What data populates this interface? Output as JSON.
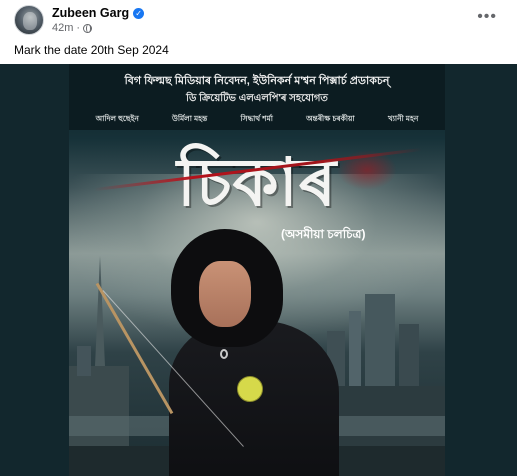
{
  "post": {
    "author": "Zubeen Garg",
    "verified_glyph": "✓",
    "time": "42m",
    "separator": "·",
    "privacy_icon": "globe-icon",
    "more_glyph": "•••",
    "caption": "Mark the date 20th Sep 2024"
  },
  "poster": {
    "production_line1": "বিগ ফিল্মছ মিডিয়াৰ নিবেদন, ইউনিকৰ্ন ম'শ্বন পিক্সাৰ্চ প্ৰডাকচন্‌",
    "production_line2": "ডি ক্ৰিয়েটিভ এলএলপি'ৰ সহযোগত",
    "cast": [
      "আদিল হুছেইন",
      "উৰ্মিলা মহন্ত",
      "সিদ্ধাৰ্থ শৰ্মা",
      "অন্তৰীক্ষ চৰকীয়া",
      "খ্যানী মহন"
    ],
    "title": "চিকাৰ",
    "subtitle": "(অসমীয়া চলচিত্ৰ)"
  },
  "colors": {
    "accent": "#1877f2",
    "poster_dark": "#0c1c21",
    "media_bg": "#12272d",
    "blood_red": "#b5121b"
  }
}
